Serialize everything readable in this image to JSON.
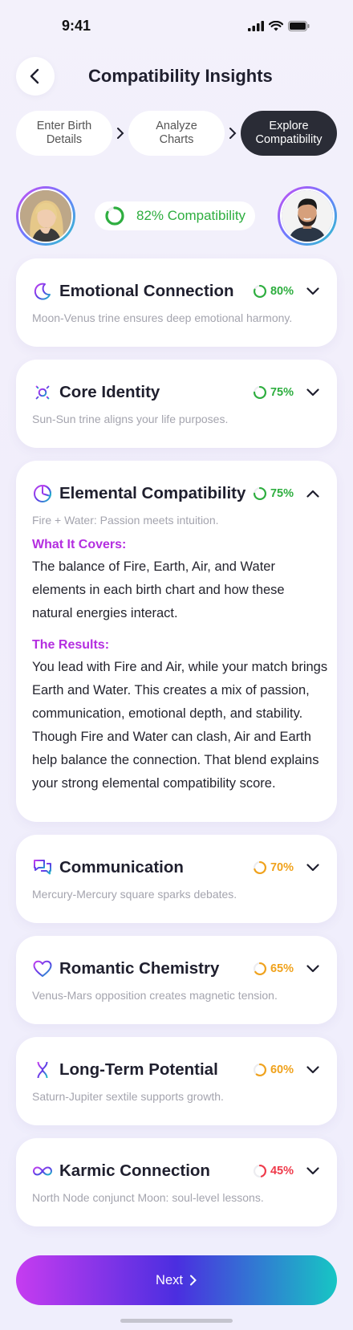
{
  "status_bar": {
    "time": "9:41"
  },
  "header": {
    "title": "Compatibility Insights"
  },
  "steps": [
    {
      "label_line1": "Enter Birth",
      "label_line2": "Details"
    },
    {
      "label_line1": "Analyze",
      "label_line2": "Charts"
    },
    {
      "label_line1": "Explore",
      "label_line2": "Compatibility"
    }
  ],
  "match": {
    "compatibility_label": "82% Compatibility",
    "compatibility_value": 0.82
  },
  "colors": {
    "green": "#2eae3f",
    "orange": "#f0a21c",
    "red": "#ef3a4a",
    "purple": "#b42ee0"
  },
  "cards": [
    {
      "title": "Emotional Connection",
      "score_label": "80%",
      "score": 0.8,
      "subtitle": "Moon-Venus trine ensures deep emotional harmony.",
      "icon": "moon-icon"
    },
    {
      "title": "Core Identity",
      "score_label": "75%",
      "score": 0.75,
      "subtitle": "Sun-Sun trine aligns your life purposes.",
      "icon": "sun-icon"
    },
    {
      "title": "Elemental Compatibility",
      "score_label": "75%",
      "score": 0.75,
      "subtitle": "Fire + Water: Passion meets intuition.",
      "icon": "elements-icon",
      "covers_heading": "What It Covers:",
      "covers_lines": [
        "The balance of Fire, Earth, Air, and Water",
        "elements in each birth chart and how these",
        "natural energies interact."
      ],
      "results_heading": "The Results:",
      "results_lines": [
        "You lead with Fire and Air, while your match brings",
        "Earth and Water. This creates a mix of passion,",
        "communication, emotional depth, and stability.",
        "Though Fire and Water can clash, Air and Earth",
        "help balance the connection. That blend explains",
        "your strong elemental compatibility score."
      ]
    },
    {
      "title": "Communication",
      "score_label": "70%",
      "score": 0.7,
      "subtitle": "Mercury-Mercury square sparks debates.",
      "icon": "chat-bubbles-icon"
    },
    {
      "title": "Romantic Chemistry",
      "score_label": "65%",
      "score": 0.65,
      "subtitle": "Venus-Mars opposition creates magnetic tension.",
      "icon": "heart-icon"
    },
    {
      "title": "Long-Term Potential",
      "score_label": "60%",
      "score": 0.6,
      "subtitle": "Saturn-Jupiter sextile supports growth.",
      "icon": "hourglass-icon"
    },
    {
      "title": "Karmic Connection",
      "score_label": "45%",
      "score": 0.45,
      "subtitle": "North Node conjunct Moon: soul-level lessons.",
      "icon": "infinity-icon"
    }
  ],
  "next_button": {
    "label": "Next"
  }
}
